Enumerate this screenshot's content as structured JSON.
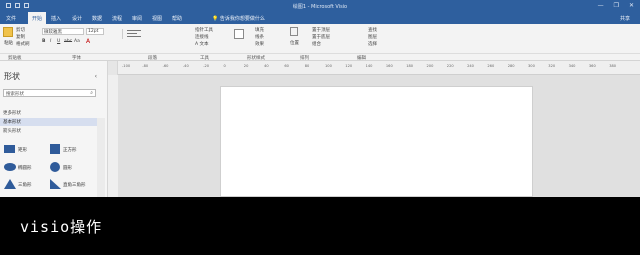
{
  "window": {
    "title": "绘图1 - Microsoft Visio",
    "minimize": "—",
    "restore": "❐",
    "close": "✕"
  },
  "menu": {
    "tabs": [
      "文件",
      "开始",
      "插入",
      "设计",
      "数据",
      "流程",
      "审阅",
      "视图",
      "帮助"
    ],
    "active_tab": "开始",
    "tell_me": "告诉我你想要做什么",
    "user": "共享"
  },
  "ribbon": {
    "paste": "粘贴",
    "cut": "剪切",
    "copy": "复制",
    "format_painter": "格式刷",
    "font_name": "微软雅黑",
    "font_size": "12pt",
    "bold": "B",
    "italic": "I",
    "underline": "U",
    "strike": "abc",
    "font_case": "Aa",
    "font_color": "A",
    "pointer_tool": "指针工具",
    "connector": "连接线",
    "text": "A 文本",
    "fill": "填充",
    "line": "线条",
    "effects": "效果",
    "position": "位置",
    "bring_forward": "置于顶层",
    "send_backward": "置于底层",
    "group": "组合",
    "find": "查找",
    "layers": "图层",
    "select": "选择"
  },
  "group_labels": [
    "剪贴板",
    "字体",
    "段落",
    "工具",
    "形状样式",
    "排列",
    "编辑"
  ],
  "shapes_pane": {
    "title": "形状",
    "collapse": "‹",
    "search_placeholder": "搜索形状",
    "more_shapes": "更多形状",
    "stencil_active": "基本形状",
    "stencil_other": "箭头形状",
    "items": [
      {
        "label": "矩形",
        "icon": "rectangle-icon"
      },
      {
        "label": "正方形",
        "icon": "square-icon"
      },
      {
        "label": "椭圆形",
        "icon": "ellipse-icon"
      },
      {
        "label": "圆形",
        "icon": "circle-icon"
      },
      {
        "label": "三角形",
        "icon": "triangle-icon"
      },
      {
        "label": "直角三角形",
        "icon": "right-triangle-icon"
      }
    ]
  },
  "ruler_marks": [
    "-100",
    "-80",
    "-60",
    "-40",
    "-20",
    "0",
    "20",
    "40",
    "60",
    "80",
    "100",
    "120",
    "140",
    "160",
    "180",
    "200",
    "220",
    "240",
    "260",
    "280",
    "300",
    "320",
    "340",
    "360",
    "380"
  ],
  "caption": "visio操作",
  "colors": {
    "title_bar": "#2e5f9e",
    "page": "#ffffff",
    "shape_fill": "#2f5b9a",
    "caption_bg": "#000000"
  }
}
